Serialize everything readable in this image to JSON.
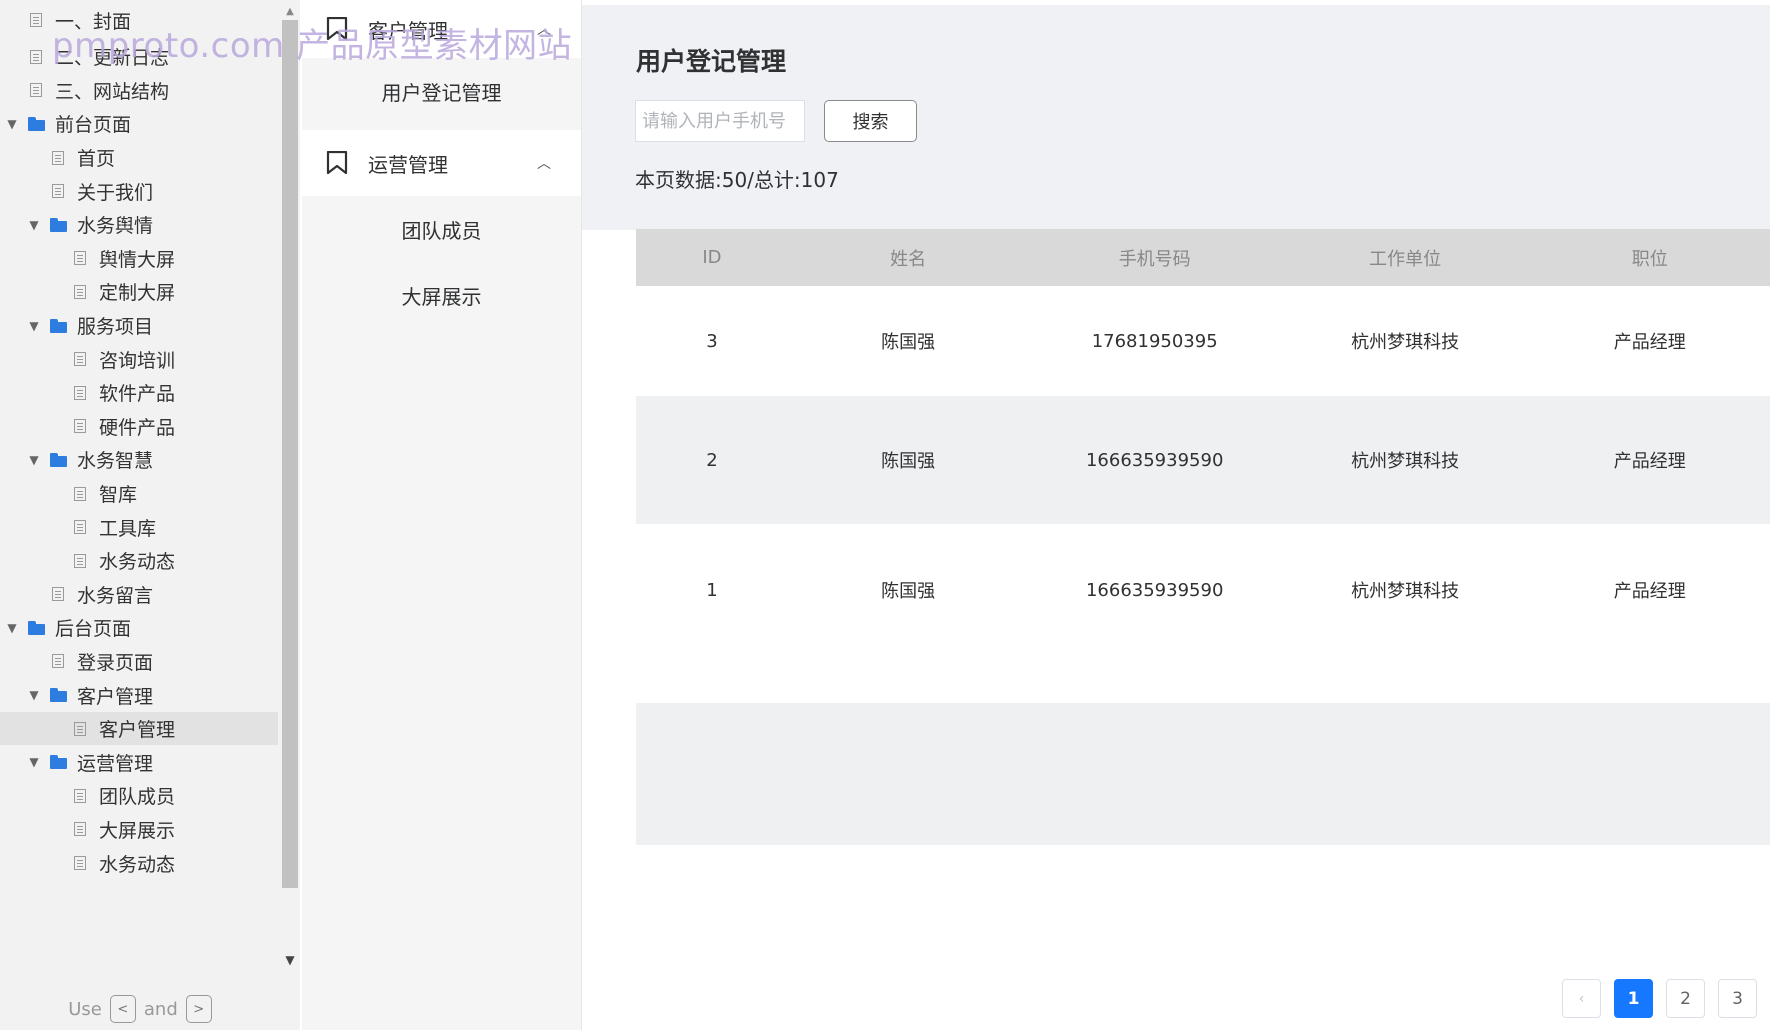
{
  "watermark": "pmproto.com 产品原型素材网站",
  "tree": {
    "items": [
      {
        "label": "一、封面",
        "type": "page",
        "level": 0
      },
      {
        "label": "二、更新日志",
        "type": "page",
        "level": 0
      },
      {
        "label": "三、网站结构",
        "type": "page",
        "level": 0
      },
      {
        "label": "前台页面",
        "type": "folder",
        "level": 0
      },
      {
        "label": "首页",
        "type": "page",
        "level": 1
      },
      {
        "label": "关于我们",
        "type": "page",
        "level": 1
      },
      {
        "label": "水务舆情",
        "type": "folder",
        "level": 1
      },
      {
        "label": "舆情大屏",
        "type": "page",
        "level": 2
      },
      {
        "label": "定制大屏",
        "type": "page",
        "level": 2
      },
      {
        "label": "服务项目",
        "type": "folder",
        "level": 1
      },
      {
        "label": "咨询培训",
        "type": "page",
        "level": 2
      },
      {
        "label": "软件产品",
        "type": "page",
        "level": 2
      },
      {
        "label": "硬件产品",
        "type": "page",
        "level": 2
      },
      {
        "label": "水务智慧",
        "type": "folder",
        "level": 1
      },
      {
        "label": "智库",
        "type": "page",
        "level": 2
      },
      {
        "label": "工具库",
        "type": "page",
        "level": 2
      },
      {
        "label": "水务动态",
        "type": "page",
        "level": 2
      },
      {
        "label": "水务留言",
        "type": "page",
        "level": 1
      },
      {
        "label": "后台页面",
        "type": "folder",
        "level": 0
      },
      {
        "label": "登录页面",
        "type": "page",
        "level": 1
      },
      {
        "label": "客户管理",
        "type": "folder",
        "level": 1
      },
      {
        "label": "客户管理",
        "type": "page",
        "level": 2,
        "active": true
      },
      {
        "label": "运营管理",
        "type": "folder",
        "level": 1
      },
      {
        "label": "团队成员",
        "type": "page",
        "level": 2
      },
      {
        "label": "大屏展示",
        "type": "page",
        "level": 2
      },
      {
        "label": "水务动态",
        "type": "page",
        "level": 2
      }
    ],
    "footer": {
      "use": "Use",
      "and": "and",
      "key_prev": "<",
      "key_next": ">"
    }
  },
  "menu": {
    "groups": [
      {
        "title": "客户管理",
        "items": [
          "用户登记管理"
        ]
      },
      {
        "title": "运营管理",
        "items": [
          "团队成员",
          "大屏展示"
        ]
      }
    ]
  },
  "main": {
    "title": "用户登记管理",
    "search": {
      "placeholder": "请输入用户手机号",
      "value": "",
      "button": "搜索"
    },
    "count_text": "本页数据:50/总计:107",
    "table": {
      "columns": [
        "ID",
        "姓名",
        "手机号码",
        "工作单位",
        "职位"
      ],
      "rows": [
        [
          "3",
          "陈国强",
          "17681950395",
          "杭州梦琪科技",
          "产品经理"
        ],
        [
          "2",
          "陈国强",
          "166635939590",
          "杭州梦琪科技",
          "产品经理"
        ],
        [
          "1",
          "陈国强",
          "166635939590",
          "杭州梦琪科技",
          "产品经理"
        ]
      ]
    },
    "pagination": {
      "prev_icon": "chevron-left-icon",
      "pages": [
        "1",
        "2",
        "3"
      ],
      "current": "1"
    }
  },
  "colors": {
    "accent": "#1677ff",
    "folder": "#2d7de0",
    "header_bg": "#d9d9d9"
  }
}
